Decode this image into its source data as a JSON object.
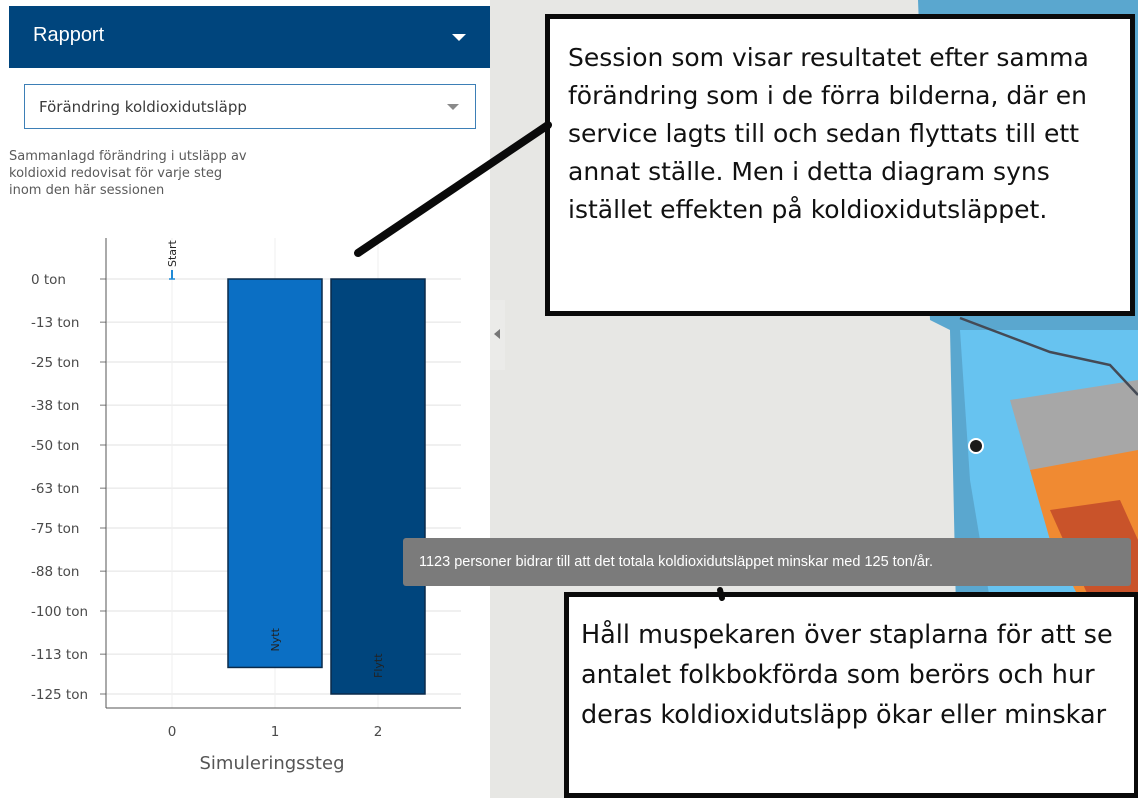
{
  "panel": {
    "title": "Rapport",
    "metric_select": {
      "value": "Förändring koldioxidutsläpp"
    },
    "description": "Sammanlagd förändring i utsläpp av\nkoldioxid redovisat för varje steg\ninom den här sessionen"
  },
  "chart_data": {
    "type": "bar",
    "xlabel": "Simuleringssteg",
    "ylabel": "",
    "x": [
      0,
      1,
      2
    ],
    "x_tick_labels": [
      "0",
      "1",
      "2"
    ],
    "bar_labels": [
      "Start",
      "Nytt",
      "Flytt"
    ],
    "values": [
      0,
      -117,
      -125
    ],
    "bar_colors": [
      "#1f8ad6",
      "#0b6fc4",
      "#00457d"
    ],
    "y_ticks": [
      0,
      -13,
      -25,
      -38,
      -50,
      -63,
      -75,
      -88,
      -100,
      -113,
      -125
    ],
    "y_tick_labels": [
      "0 ton",
      "-13 ton",
      "-25 ton",
      "-38 ton",
      "-50 ton",
      "-63 ton",
      "-75 ton",
      "-88 ton",
      "-100 ton",
      "-113 ton",
      "-125 ton"
    ],
    "ylim": [
      -125,
      0
    ],
    "grid": true
  },
  "tooltip": {
    "text": "1123 personer bidrar till att det totala koldioxidutsläppet minskar med 125 ton/år."
  },
  "callouts": {
    "top": "Session som visar resultatet efter samma förändring som i de förra bilderna, där en service lagts till och sedan flyttats till ett annat ställe. Men i detta diagram syns istället effekten på koldioxidutsläppet.",
    "bottom": "Håll muspekaren över staplarna för att se antalet folkbokförda som berörs och hur deras koldioxidutsläpp ökar eller minskar"
  },
  "icons": {
    "header_dropdown": "chevron-down-icon",
    "select_dropdown": "chevron-down-icon",
    "collapse": "chevron-left-icon",
    "map_marker": "location-dot-icon"
  }
}
